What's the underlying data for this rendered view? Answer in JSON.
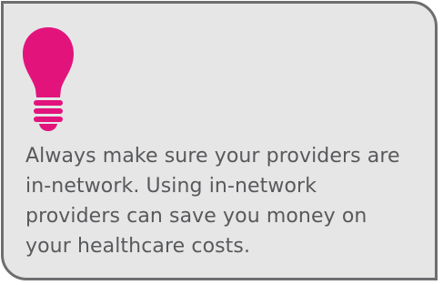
{
  "tip": {
    "icon": "lightbulb-icon",
    "icon_color": "#e2147c",
    "text": "Always make sure your providers are in-network. Using in-network providers can save you money on your healthcare costs."
  },
  "colors": {
    "background": "#e6e6e7",
    "border": "#6d6e70",
    "text": "#58595b"
  }
}
